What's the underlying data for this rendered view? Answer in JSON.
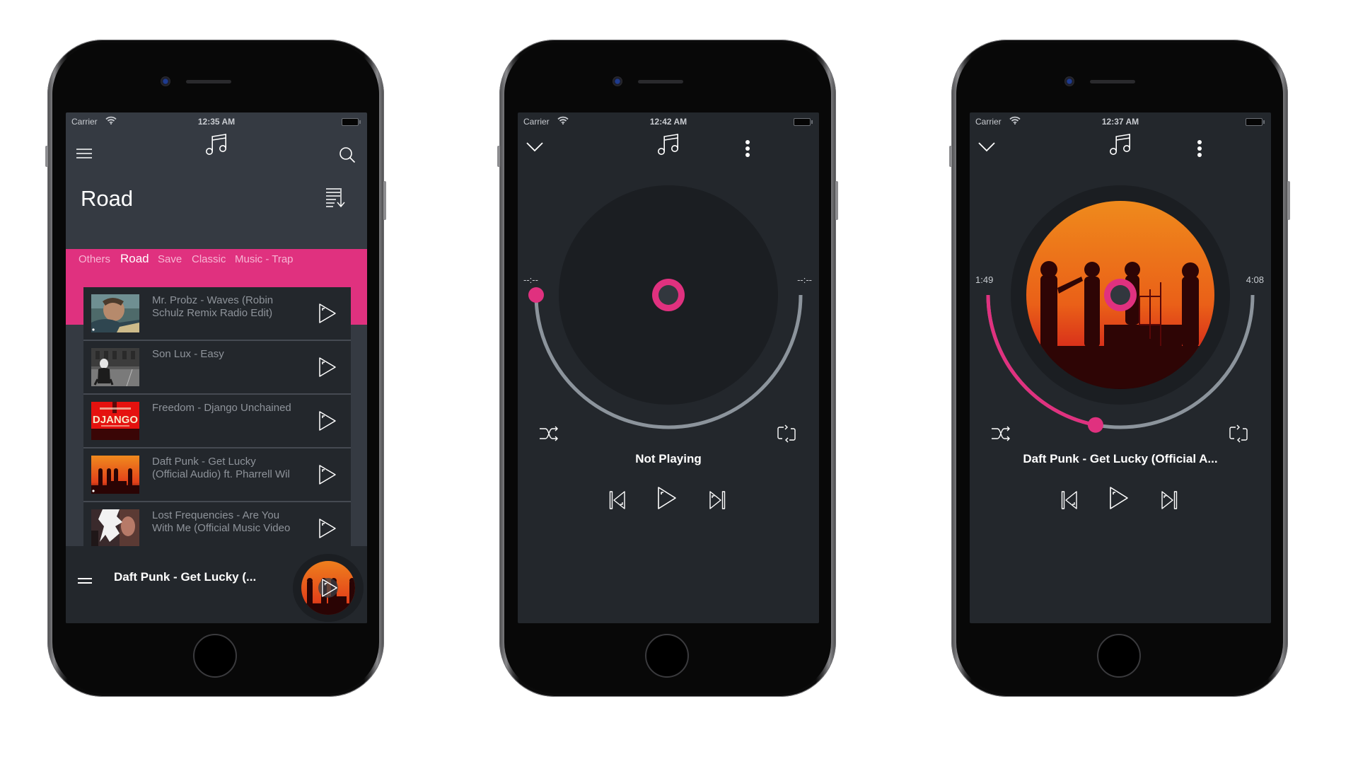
{
  "colors": {
    "accent": "#e0317f",
    "screen_bg": "#23272c",
    "list_header_bg": "#353a42",
    "disc_bg": "#1b1e22",
    "track_arc": "#8c949c"
  },
  "phones": [
    {
      "status": {
        "carrier": "Carrier",
        "time": "12:35 AM"
      },
      "header": {
        "menu_icon": "hamburger-icon",
        "logo_icon": "music-note-icon",
        "search_icon": "search-icon"
      },
      "page_title": "Road",
      "sort_icon": "sort-descending-icon",
      "tabs": [
        {
          "label": "Others",
          "active": false
        },
        {
          "label": "Road",
          "active": true
        },
        {
          "label": "Save",
          "active": false
        },
        {
          "label": "Classic",
          "active": false
        },
        {
          "label": "Music - Trap",
          "active": false
        }
      ],
      "tracks": [
        {
          "title": "Mr. Probz - Waves (Robin\nSchulz Remix Radio Edit)",
          "art": "probz"
        },
        {
          "title": "Son Lux - Easy",
          "art": "sonlux"
        },
        {
          "title": "Freedom - Django Unchained",
          "art": "django"
        },
        {
          "title": "Daft Punk - Get Lucky\n(Official Audio) ft. Pharrell Wil",
          "art": "daftpunk"
        },
        {
          "title": "Lost Frequencies - Are You\nWith Me (Official Music Video",
          "art": "lostfreq"
        }
      ],
      "mini_player": {
        "title": "Daft Punk - Get Lucky (...",
        "handle_icon": "drag-handle-icon",
        "play_icon": "play-icon"
      }
    },
    {
      "status": {
        "carrier": "Carrier",
        "time": "12:42 AM"
      },
      "header": {
        "collapse_icon": "chevron-down-icon",
        "logo_icon": "music-note-icon",
        "more_icon": "more-vertical-icon"
      },
      "elapsed": "--:--",
      "duration": "--:--",
      "progress": 0,
      "has_artwork": false,
      "title": "Not Playing",
      "controls": {
        "shuffle": "shuffle-icon",
        "repeat": "repeat-icon",
        "prev": "skip-previous-icon",
        "play": "play-icon",
        "next": "skip-next-icon"
      }
    },
    {
      "status": {
        "carrier": "Carrier",
        "time": "12:37 AM"
      },
      "header": {
        "collapse_icon": "chevron-down-icon",
        "logo_icon": "music-note-icon",
        "more_icon": "more-vertical-icon"
      },
      "elapsed": "1:49",
      "duration": "4:08",
      "progress": 0.44,
      "has_artwork": true,
      "title": "Daft Punk - Get Lucky (Official A...",
      "controls": {
        "shuffle": "shuffle-icon",
        "repeat": "repeat-icon",
        "prev": "skip-previous-icon",
        "play": "play-icon",
        "next": "skip-next-icon"
      }
    }
  ]
}
